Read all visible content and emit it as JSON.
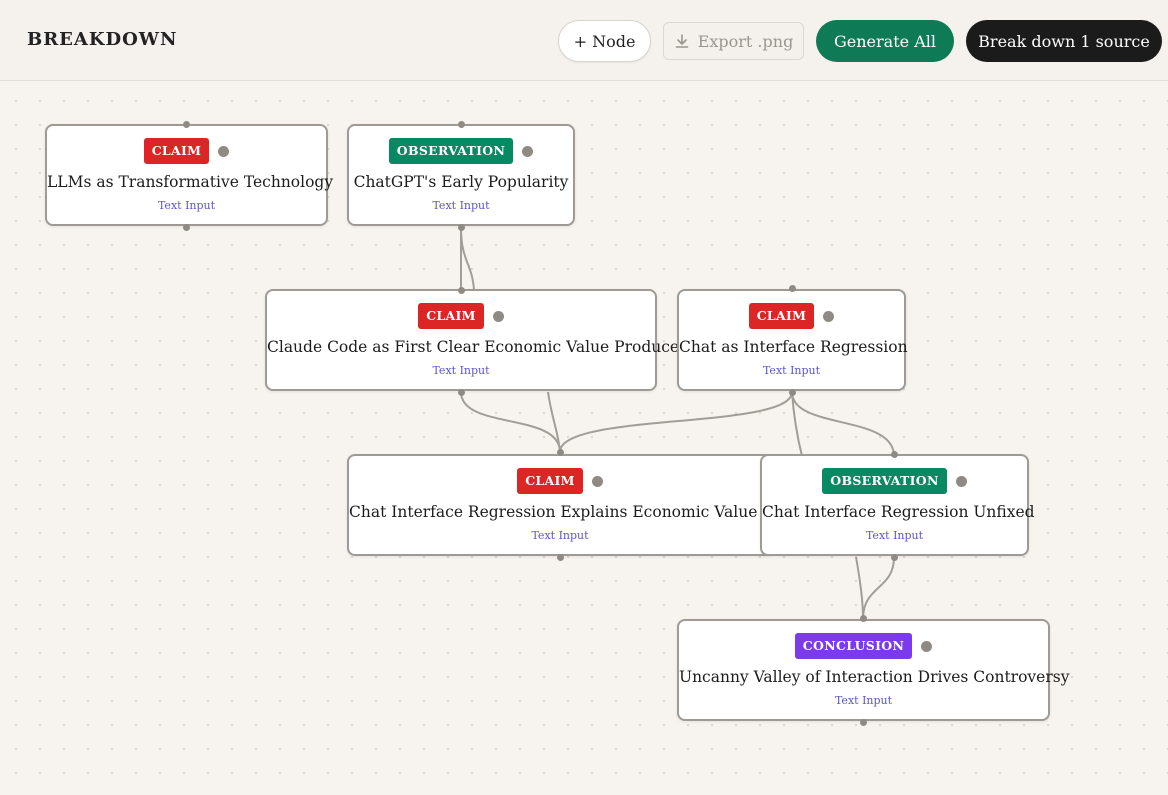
{
  "header": {
    "title": "BREAKDOWN",
    "add_node_label": "+ Node",
    "export_label": "Export .png",
    "generate_label": "Generate All",
    "breakdown_label": "Break down 1 source"
  },
  "icons": {
    "export": "download-icon",
    "status": "status-dot"
  },
  "colors": {
    "claim": "#dc2626",
    "observation": "#078a63",
    "conclusion": "#7c3aed",
    "generate_button": "#0f7a56",
    "breakdown_button": "#1b1b1b",
    "node_subtitle": "#5b56c9"
  },
  "nodes": [
    {
      "type": "CLAIM",
      "title": "LLMs as Transformative Technology",
      "subtitle": "Text Input"
    },
    {
      "type": "OBSERVATION",
      "title": "ChatGPT's Early Popularity",
      "subtitle": "Text Input"
    },
    {
      "type": "CLAIM",
      "title": "Claude Code as First Clear Economic Value Producer",
      "subtitle": "Text Input"
    },
    {
      "type": "CLAIM",
      "title": "Chat as Interface Regression",
      "subtitle": "Text Input"
    },
    {
      "type": "CLAIM",
      "title": "Chat Interface Regression Explains Economic Value Delay",
      "subtitle": "Text Input"
    },
    {
      "type": "OBSERVATION",
      "title": "Chat Interface Regression Unfixed",
      "subtitle": "Text Input"
    },
    {
      "type": "CONCLUSION",
      "title": "Uncanny Valley of Interaction Drives Controversy",
      "subtitle": "Text Input"
    }
  ]
}
